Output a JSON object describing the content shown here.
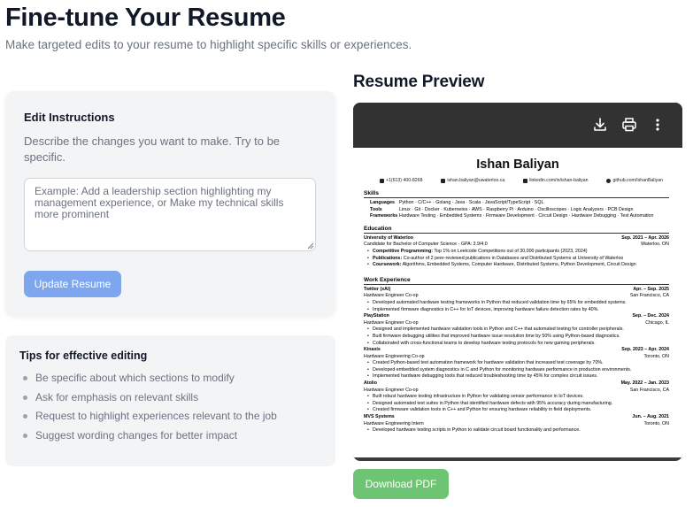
{
  "header": {
    "title": "Fine-tune Your Resume",
    "subtitle": "Make targeted edits to your resume to highlight specific skills or experiences."
  },
  "edit": {
    "title": "Edit Instructions",
    "description": "Describe the changes you want to make. Try to be specific.",
    "placeholder": "Example: Add a leadership section highlighting my management experience, or Make my technical skills more prominent",
    "value": "",
    "button_label": "Update Resume"
  },
  "tips": {
    "title": "Tips for effective editing",
    "items": [
      "Be specific about which sections to modify",
      "Ask for emphasis on relevant skills",
      "Request to highlight experiences relevant to the job",
      "Suggest wording changes for better impact"
    ]
  },
  "preview": {
    "title": "Resume Preview",
    "toolbar_icons": [
      "download-icon",
      "print-icon",
      "more-vert-icon"
    ],
    "download_button_label": "Download PDF"
  },
  "resume": {
    "name": "Ishan Baliyan",
    "contacts": [
      {
        "icon": "phone-icon",
        "text": "+1(613) 400-8268"
      },
      {
        "icon": "mail-icon",
        "text": "ishan.baliyan@uwaterloo.ca"
      },
      {
        "icon": "linkedin-icon",
        "text": "linkedin.com/in/ishan-baliyan"
      },
      {
        "icon": "github-icon",
        "text": "github.com/IshanBaliyan"
      }
    ],
    "skills_heading": "Skills",
    "skills": [
      {
        "label": "Languages",
        "value": "Python · C/C++ · Golang · Java · Scala · JavaScript/TypeScript · SQL"
      },
      {
        "label": "Tools",
        "value": "Linux · Git · Docker · Kubernetes · AWS · Raspberry Pi · Arduino · Oscilloscopes · Logic Analyzers · PCB Design"
      },
      {
        "label": "Frameworks",
        "value": "Hardware Testing · Embedded Systems · Firmware Development · Circuit Design · Hardware Debugging · Test Automation"
      }
    ],
    "education_heading": "Education",
    "education": {
      "school": "University of Waterloo",
      "dates": "Sep. 2021 – Apr. 2026",
      "degree": "Candidate for Bachelor of Computer Science - GPA: 3.9/4.0",
      "location": "Waterloo, ON",
      "bullets": [
        {
          "label": "Competitive Programming:",
          "text": "Top 1% on Leetcode Competitions out of 30,000 participants (2023, 2024)"
        },
        {
          "label": "Publications:",
          "text": "Co-author of 2 peer-reviewed publications in Databases and Distributed Systems at University of Waterloo"
        },
        {
          "label": "Coursework:",
          "text": "Algorithms, Embedded Systems, Computer Hardware, Distributed Systems, Python Development, Circuit Design"
        }
      ]
    },
    "experience_heading": "Work Experience",
    "experience": [
      {
        "company": "Twitter (xAI)",
        "dates": "Apr. – Sep. 2025",
        "role": "Hardware Engineer Co-op",
        "location": "San Francisco, CA",
        "bullets": [
          "Developed automated hardware testing frameworks in Python that reduced validation time by 65% for embedded systems.",
          "Implemented firmware diagnostics in C++ for IoT devices, improving hardware failure detection rates by 40%."
        ]
      },
      {
        "company": "PlayStation",
        "dates": "Sep. – Dec. 2024",
        "role": "Hardware Engineer Co-op",
        "location": "Chicago, IL",
        "bullets": [
          "Designed and implemented hardware validation tools in Python and C++ that automated testing for controller peripherals.",
          "Built firmware debugging utilities that improved hardware issue resolution time by 50% using Python-based diagnostics.",
          "Collaborated with cross-functional teams to develop hardware testing protocols for new gaming peripherals."
        ]
      },
      {
        "company": "Kinaxis",
        "dates": "Sep. 2023 – Apr. 2024",
        "role": "Hardware Engineering Co-op",
        "location": "Toronto, ON",
        "bullets": [
          "Created Python-based test automation framework for hardware validation that increased test coverage by 70%.",
          "Developed embedded system diagnostics in C and Python for monitoring hardware performance in production environments.",
          "Implemented hardware debugging tools that reduced troubleshooting time by 45% for complex circuit issues."
        ]
      },
      {
        "company": "Atolio",
        "dates": "May. 2022 – Jan. 2023",
        "role": "Hardware Engineer Co-op",
        "location": "San Francisco, CA",
        "bullets": [
          "Built robust hardware testing infrastructure in Python for validating sensor performance in IoT devices.",
          "Designed automated test suites in Python that identified hardware defects with 95% accuracy during manufacturing.",
          "Created firmware validation tools in C++ and Python for ensuring hardware reliability in field deployments."
        ]
      },
      {
        "company": "MVS Systems",
        "dates": "Jun. – Aug. 2021",
        "role": "Hardware Engineering Intern",
        "location": "Toronto, ON",
        "bullets": [
          "Developed hardware testing scripts in Python to validate circuit board functionality and performance."
        ]
      }
    ]
  }
}
